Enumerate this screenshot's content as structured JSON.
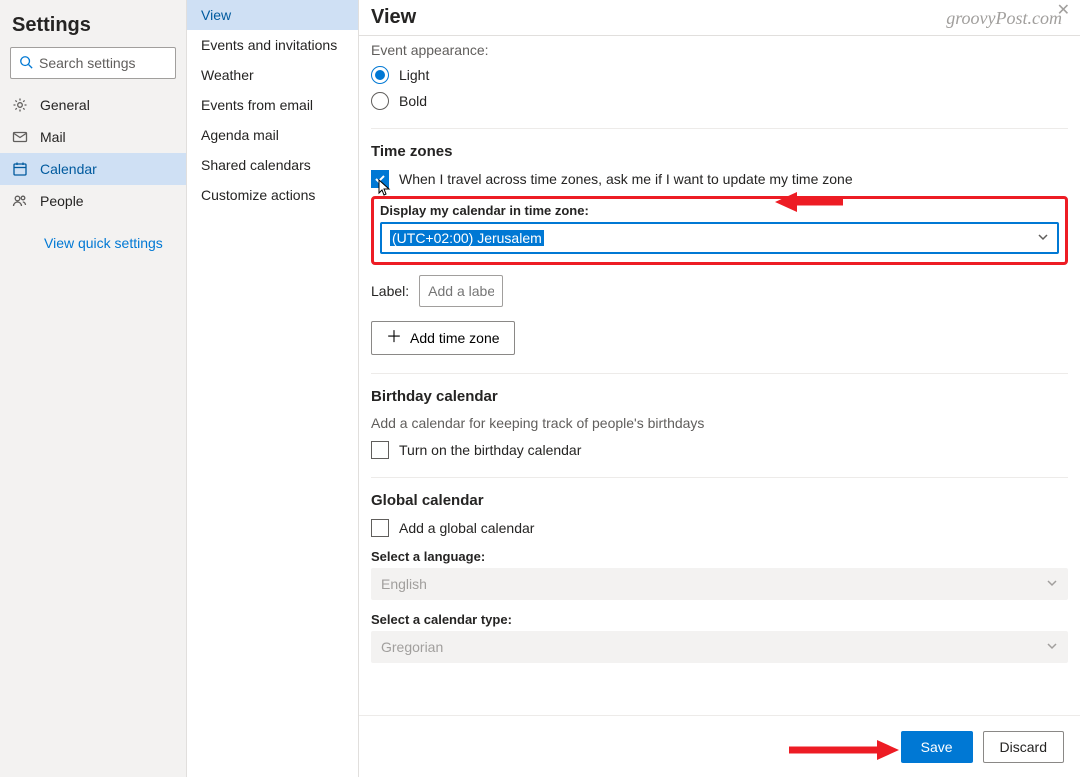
{
  "header": {
    "title": "Settings",
    "search_placeholder": "Search settings"
  },
  "nav": {
    "items": [
      {
        "label": "General"
      },
      {
        "label": "Mail"
      },
      {
        "label": "Calendar"
      },
      {
        "label": "People"
      }
    ],
    "quick_link": "View quick settings"
  },
  "subnav": {
    "items": [
      {
        "label": "View"
      },
      {
        "label": "Events and invitations"
      },
      {
        "label": "Weather"
      },
      {
        "label": "Events from email"
      },
      {
        "label": "Agenda mail"
      },
      {
        "label": "Shared calendars"
      },
      {
        "label": "Customize actions"
      }
    ]
  },
  "panel": {
    "title": "View",
    "watermark": "groovyPost.com",
    "event_appearance": {
      "heading": "Event appearance:",
      "light": "Light",
      "bold": "Bold"
    },
    "time_zones": {
      "heading": "Time zones",
      "travel_label": "When I travel across time zones, ask me if I want to update my time zone",
      "display_label": "Display my calendar in time zone:",
      "tz_value": "(UTC+02:00) Jerusalem",
      "label_label": "Label:",
      "label_placeholder": "Add a label",
      "add_button": "Add time zone"
    },
    "birthday": {
      "heading": "Birthday calendar",
      "subtext": "Add a calendar for keeping track of people's birthdays",
      "toggle_label": "Turn on the birthday calendar"
    },
    "global": {
      "heading": "Global calendar",
      "toggle_label": "Add a global calendar",
      "lang_label": "Select a language:",
      "lang_value": "English",
      "caltype_label": "Select a calendar type:",
      "caltype_value": "Gregorian"
    }
  },
  "footer": {
    "save": "Save",
    "discard": "Discard"
  }
}
